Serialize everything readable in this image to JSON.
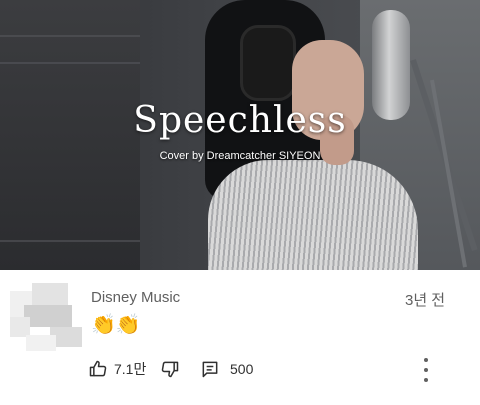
{
  "video": {
    "title": "Speechless",
    "subtitle": "Cover by Dreamcatcher SIYEON"
  },
  "comment": {
    "author": "Disney Music",
    "time": "3년 전",
    "text": "👏👏",
    "likes": "7.1만",
    "replies": "500"
  },
  "icons": {
    "like": "thumbs-up-icon",
    "dislike": "thumbs-down-icon",
    "reply": "comment-icon",
    "more": "more-vertical-icon"
  },
  "colors": {
    "meta_text": "#606060",
    "action_text": "#303030"
  }
}
